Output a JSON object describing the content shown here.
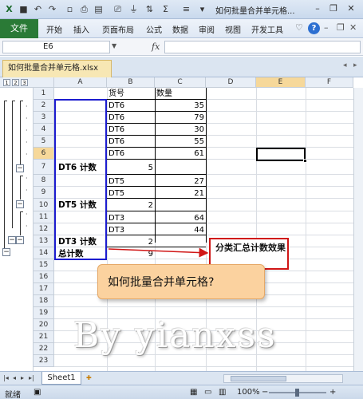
{
  "window": {
    "title": "如何批量合并单元格...",
    "minimize": "–",
    "restore": "❐",
    "close": "✕"
  },
  "ribbon": {
    "file": "文件",
    "tabs": [
      "开始",
      "插入",
      "页面布局",
      "公式",
      "数据",
      "审阅",
      "视图",
      "开发工具"
    ],
    "help": "?"
  },
  "formula_bar": {
    "name_box": "E6",
    "fx": "fx",
    "value": ""
  },
  "workbook": {
    "tab_label": "如何批量合并单元格.xlsx"
  },
  "outline": {
    "levels": [
      "1",
      "2",
      "3"
    ],
    "collapse": "−"
  },
  "columns": [
    "A",
    "B",
    "C",
    "D",
    "E",
    "F"
  ],
  "rows": [
    "1",
    "2",
    "3",
    "4",
    "5",
    "6",
    "7",
    "8",
    "9",
    "10",
    "11",
    "12",
    "13",
    "14",
    "15",
    "16",
    "17",
    "18",
    "19",
    "20",
    "21",
    "22",
    "23"
  ],
  "sheet": {
    "headers": {
      "b": "货号",
      "c": "数量"
    },
    "records": [
      {
        "b": "DT6",
        "c": "35"
      },
      {
        "b": "DT6",
        "c": "79"
      },
      {
        "b": "DT6",
        "c": "30"
      },
      {
        "b": "DT6",
        "c": "55"
      },
      {
        "b": "DT6",
        "c": "61"
      },
      {
        "b": "DT5",
        "c": "27"
      },
      {
        "b": "DT5",
        "c": "21"
      },
      {
        "b": "DT3",
        "c": "64"
      },
      {
        "b": "DT3",
        "c": "44"
      }
    ],
    "subtotals": [
      {
        "label": "DT6 计数",
        "value": "5"
      },
      {
        "label": "DT5 计数",
        "value": "2"
      },
      {
        "label": "DT3 计数",
        "value": "2"
      },
      {
        "label": "总计数",
        "value": "9"
      }
    ]
  },
  "annotations": {
    "red_callout": "分类汇总计数效果",
    "orange_callout": "如何批量合并单元格?",
    "watermark": "By yianxss"
  },
  "sheet_tabs": [
    "Sheet1"
  ],
  "status": {
    "ready": "就绪",
    "zoom": "100%",
    "zoom_minus": "−",
    "zoom_plus": "+"
  },
  "colors": {
    "file_tab": "#2a7a36",
    "highlight_rect": "#1c1ccf",
    "red_callout_border": "#d01616",
    "orange_callout_fill": "#fbd29f"
  }
}
